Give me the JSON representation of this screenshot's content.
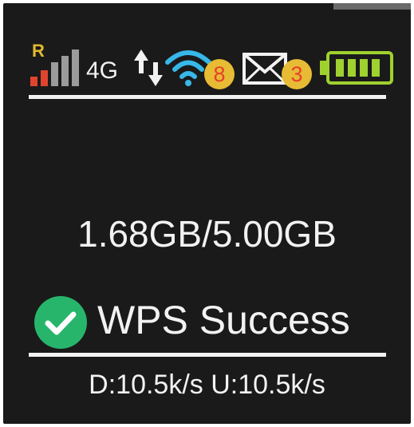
{
  "status_bar": {
    "roaming_indicator": "R",
    "network_type": "4G",
    "signal_icon": "signal-bars-icon",
    "data_activity_icon": "up-down-arrows-icon",
    "wifi_icon": "wifi-icon",
    "wifi_clients": "8",
    "message_icon": "envelope-icon",
    "unread_messages": "3",
    "battery_icon": "battery-full-icon",
    "battery_level": 1.0
  },
  "main": {
    "data_usage": "1.68GB/5.00GB",
    "wps_status": "WPS Success",
    "wps_status_icon": "check-circle-icon"
  },
  "footer": {
    "speeds": "D:10.5k/s U:10.5k/s"
  },
  "colors": {
    "background": "#1a1a1a",
    "text": "#f2f2f2",
    "roaming": "#e0b92f",
    "signal_low": "#e0442f",
    "wifi": "#37b8e8",
    "badge_bg": "#e7bb34",
    "badge_text": "#e8402a",
    "battery": "#9fd12f",
    "success": "#27b56b"
  }
}
